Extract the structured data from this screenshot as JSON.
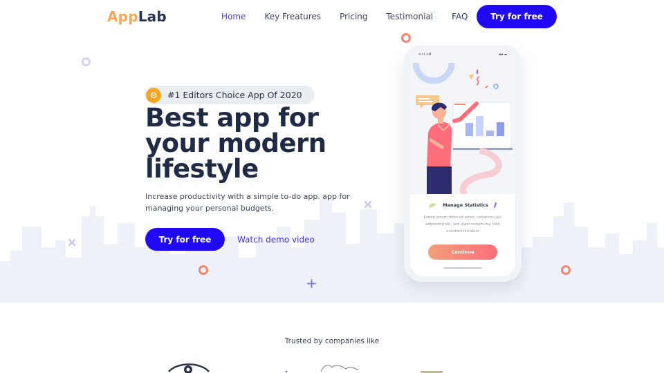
{
  "header": {
    "logo_part1": "App",
    "logo_part2": "Lab",
    "nav": [
      "Home",
      "Key Freatures",
      "Pricing",
      "Testimonial",
      "FAQ"
    ],
    "cta": "Try for free"
  },
  "hero": {
    "badge": "#1 Editors Choice App Of 2020",
    "headline": [
      "Best app for",
      "your modern",
      "lifestyle"
    ],
    "subtext": "Increase productivity with a simple to-do app. app for managing your personal budgets.",
    "cta_primary": "Try for free",
    "cta_secondary": "Watch demo video"
  },
  "phone": {
    "status_time": "9:41 AM",
    "status_icons": "▪▪ ▬",
    "card_title": "Manage Statistics",
    "card_text": "Lorem ipsum dolor sit amet, consecta-tuer adipiscing elit, sed diam nonum-my nibh euismod tincidunt",
    "button": "Continue"
  },
  "trusted": {
    "label": "Trusted by companies like"
  },
  "colors": {
    "accent": "#2108f5",
    "logo_orange": "#f5a75a",
    "badge_orange": "#f5a623",
    "heading": "#1f2a44",
    "skyline": "#eef2f8"
  }
}
